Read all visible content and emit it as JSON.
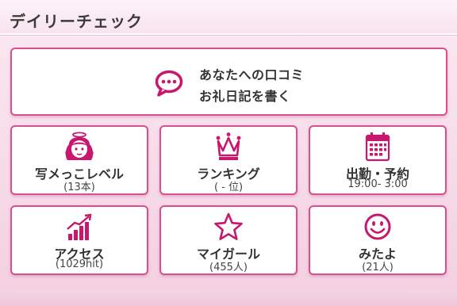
{
  "header": {
    "title": "デイリーチェック"
  },
  "colors": {
    "accent": "#d94f92",
    "icon": "#c8176e",
    "text": "#333333"
  },
  "kuchikomi": {
    "icon": "speech-bubble-icon",
    "line1": "あなたへの口コミ",
    "line2": "お礼日記を書く"
  },
  "tiles": [
    {
      "icon": "angel-girl-icon",
      "label": "写メっこレベル",
      "sub": "(13本)"
    },
    {
      "icon": "crown-icon",
      "label": "ランキング",
      "sub": "( - 位)"
    },
    {
      "icon": "calendar-icon",
      "label": "出勤・予約",
      "sub": "19:00- 3:00"
    },
    {
      "icon": "bar-chart-icon",
      "label": "アクセス",
      "sub": "(1029hit)"
    },
    {
      "icon": "star-icon",
      "label": "マイガール",
      "sub": "(455人)"
    },
    {
      "icon": "smiley-icon",
      "label": "みたよ",
      "sub": "(21人)"
    }
  ]
}
